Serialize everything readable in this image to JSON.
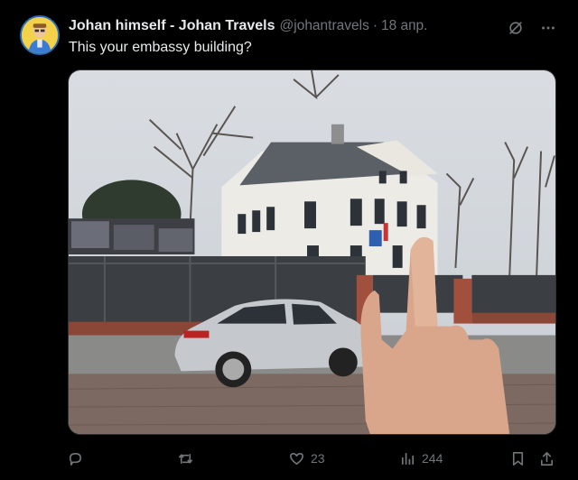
{
  "tweet": {
    "display_name": "Johan himself - Johan Travels",
    "handle": "@johantravels",
    "separator": "·",
    "date": "18 апр.",
    "text": "This your embassy building?"
  },
  "icons": {
    "grok": "grok-icon",
    "more": "more-icon",
    "reply": "reply-icon",
    "retweet": "retweet-icon",
    "like": "like-icon",
    "views": "views-icon",
    "bookmark": "bookmark-icon",
    "share": "share-icon"
  },
  "actions": {
    "reply_count": "",
    "retweet_count": "",
    "like_count": "23",
    "view_count": "244"
  },
  "colors": {
    "background": "#000000",
    "text_primary": "#e7e9ea",
    "text_secondary": "#71767b"
  }
}
